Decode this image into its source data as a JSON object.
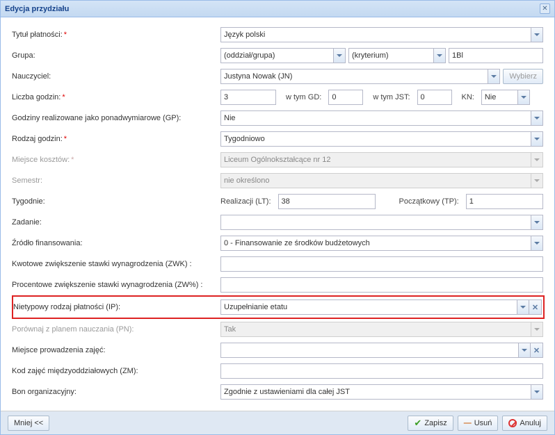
{
  "window": {
    "title": "Edycja przydziału"
  },
  "labels": {
    "tytul_platnosci": "Tytuł płatności:",
    "grupa": "Grupa:",
    "nauczyciel": "Nauczyciel:",
    "liczba_godzin": "Liczba godzin:",
    "w_tym_gd": "w tym GD:",
    "w_tym_jst": "w tym JST:",
    "kn": "KN:",
    "gp": "Godziny realizowane jako ponadwymiarowe (GP):",
    "rodzaj_godzin": "Rodzaj godzin:",
    "miejsce_kosztow": "Miejsce kosztów:",
    "semestr": "Semestr:",
    "tygodnie": "Tygodnie:",
    "realizacji": "Realizacji (LT):",
    "poczatkowy": "Początkowy (TP):",
    "zadanie": "Zadanie:",
    "zrodlo": "Źródło finansowania:",
    "zwk": "Kwotowe zwiększenie stawki wynagrodzenia (ZWK) :",
    "zwp": "Procentowe zwiększenie stawki wynagrodzenia (ZW%) :",
    "ip": "Nietypowy rodzaj płatności (IP):",
    "pn": "Porównaj z planem nauczania (PN):",
    "miejsce_prow": "Miejsce prowadzenia zajęć:",
    "zm": "Kod zajęć międzyoddziałowych (ZM):",
    "bon": "Bon organizacyjny:"
  },
  "values": {
    "tytul_platnosci": "Język polski",
    "grupa_oddzial": "(oddział/grupa)",
    "grupa_kryterium": "(kryterium)",
    "grupa_klasa": "1Bl",
    "nauczyciel": "Justyna Nowak (JN)",
    "liczba_godzin": "3",
    "w_tym_gd": "0",
    "w_tym_jst": "0",
    "kn": "Nie",
    "gp": "Nie",
    "rodzaj_godzin": "Tygodniowo",
    "miejsce_kosztow": "Liceum Ogólnokształcące nr 12",
    "semestr": "nie określono",
    "realizacji": "38",
    "poczatkowy": "1",
    "zadanie": "",
    "zrodlo": "0 - Finansowanie ze środków budżetowych",
    "zwk": "",
    "zwp": "",
    "ip": "Uzupełnianie etatu",
    "pn": "Tak",
    "miejsce_prow": "",
    "zm": "",
    "bon": "Zgodnie z ustawieniami dla całej JST"
  },
  "buttons": {
    "wybierz": "Wybierz",
    "mniej": "Mniej <<",
    "zapisz": "Zapisz",
    "usun": "Usuń",
    "anuluj": "Anuluj"
  }
}
